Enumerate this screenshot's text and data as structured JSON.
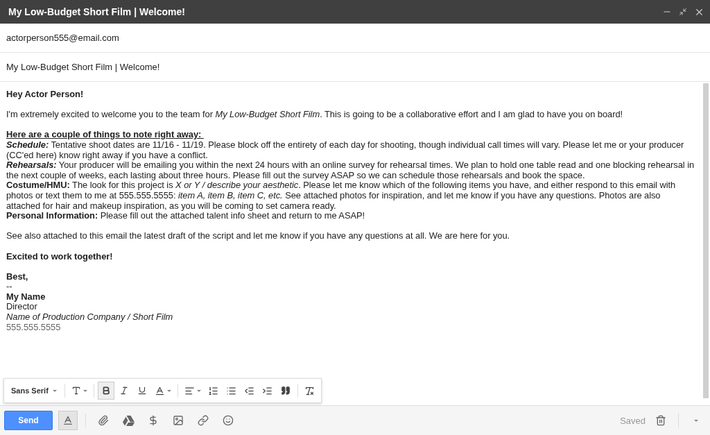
{
  "window": {
    "title": "My Low-Budget Short Film | Welcome!"
  },
  "to": "actorperson555@email.com",
  "subject": "My Low-Budget Short Film | Welcome!",
  "body": {
    "greeting": "Hey Actor Person!",
    "intro": "I'm extremely excited to welcome you to the team for *My Low-Budget Short Film*. This is going to be a collaborative effort and I am glad to have you on board!",
    "notes_heading": "Here are a couple of things to note right away: ",
    "notes": [
      {
        "kind": "bold-italic",
        "label": "Schedule:",
        "text": "Tentative shoot dates are 11/16 - 11/19. Please block off the entirety of each day for shooting, though individual call times will vary. Please let me or your producer (CC'ed here) know right away if you have a conflict."
      },
      {
        "kind": "bold-italic",
        "label": "Rehearsals:",
        "text": "Your producer will be emailing you within the next 24 hours with an online survey for rehearsal times. We plan to hold one table read and one blocking rehearsal in the next couple of weeks, each lasting about three hours. Please fill out the survey ASAP so we can schedule those rehearsals and book the space."
      },
      {
        "kind": "bold",
        "label": "Costume/HMU:",
        "text": "The look for this project is *X or Y / describe your aesthetic*. Please let me know which of the following items you have, and either respond to this email with photos or text them to me at 555.555.5555: *item A, item B, item C, etc.* See attached photos for inspiration, and let me know if you have any questions. Photos are also attached for hair and makeup inspiration, as you will be coming to set camera ready."
      },
      {
        "kind": "bold",
        "label": "Personal Information:",
        "text": "Please fill out the attached talent info sheet and return to me ASAP!"
      }
    ],
    "closing_note": "See also attached to this email the latest draft of the script and let me know if you have any questions at all. We are here for you.",
    "sign_off": "Excited to work together!",
    "signature": [
      {
        "kind": "bold",
        "text": "Best,"
      },
      {
        "kind": "plain",
        "text": "--"
      },
      {
        "kind": "bold",
        "text": "My Name"
      },
      {
        "kind": "plain",
        "text": "Director"
      },
      {
        "kind": "italic",
        "text": "Name of Production Company / Short Film"
      },
      {
        "kind": "muted",
        "text": "555.555.5555"
      }
    ]
  },
  "format_toolbar": {
    "font": "Sans Serif",
    "bold_selected": true
  },
  "bottom_bar": {
    "send": "Send",
    "format_toggle_selected": true,
    "status": "Saved"
  }
}
